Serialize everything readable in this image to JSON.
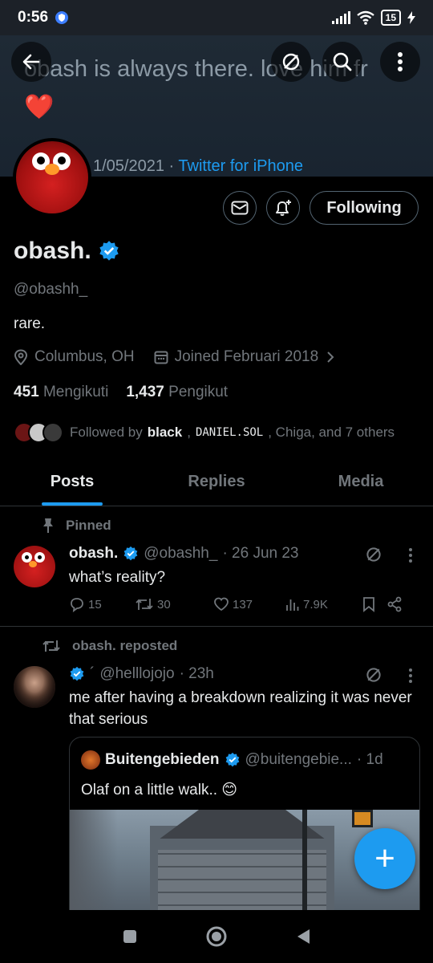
{
  "status_bar": {
    "time": "0:56",
    "battery": "15",
    "network": "4G"
  },
  "banner": {
    "text": "obash is always there. love him fr",
    "heart": "❤️",
    "date": "1/05/2021 · ",
    "source": "Twitter for iPhone"
  },
  "profile": {
    "name": "obash.",
    "handle": "@obashh_",
    "bio": "rare.",
    "location": "Columbus, OH",
    "joined": "Joined Februari 2018",
    "following_count": "451",
    "following_label": "Mengikuti",
    "followers_count": "1,437",
    "followers_label": "Pengikut",
    "followed_by_prefix": "Followed by ",
    "followed_by_1": "black",
    "followed_by_sep": ", ",
    "followed_by_2": "DANIEL.SOL",
    "followed_by_rest": ", Chiga, and 7 others",
    "following_button": "Following"
  },
  "tabs": [
    {
      "label": "Posts",
      "active": true
    },
    {
      "label": "Replies",
      "active": false
    },
    {
      "label": "Media",
      "active": false
    }
  ],
  "pinned_post": {
    "pinned_label": "Pinned",
    "name": "obash.",
    "handle": "@obashh_",
    "time": "· 26 Jun 23",
    "text": "what’s reality?",
    "replies": "15",
    "reposts": "30",
    "likes": "137",
    "views": "7.9K"
  },
  "repost": {
    "repost_label": "obash. reposted",
    "handle": "@helllojojo",
    "prefix_mark": "´",
    "time": "· 23h",
    "text": "me after having a breakdown realizing it was never that serious",
    "quote": {
      "name": "Buitengebieden",
      "handle": "@buitengebie...",
      "time": "· 1d",
      "text": "Olaf on a little walk.. 😊"
    }
  },
  "fab_label": "+",
  "colors": {
    "accent": "#1d9bf0",
    "background": "#000000",
    "muted": "#71767b",
    "text": "#e7e9ea"
  },
  "icons": [
    "back-arrow-icon",
    "grok-icon",
    "search-icon",
    "more-vertical-icon",
    "mail-icon",
    "bell-plus-icon",
    "verified-badge-icon",
    "location-pin-icon",
    "calendar-icon",
    "chevron-right-icon",
    "pin-icon",
    "reply-icon",
    "repost-icon",
    "like-icon",
    "views-icon",
    "bookmark-icon",
    "share-icon",
    "plus-icon",
    "nav-square-icon",
    "nav-circle-icon",
    "nav-back-triangle-icon"
  ]
}
